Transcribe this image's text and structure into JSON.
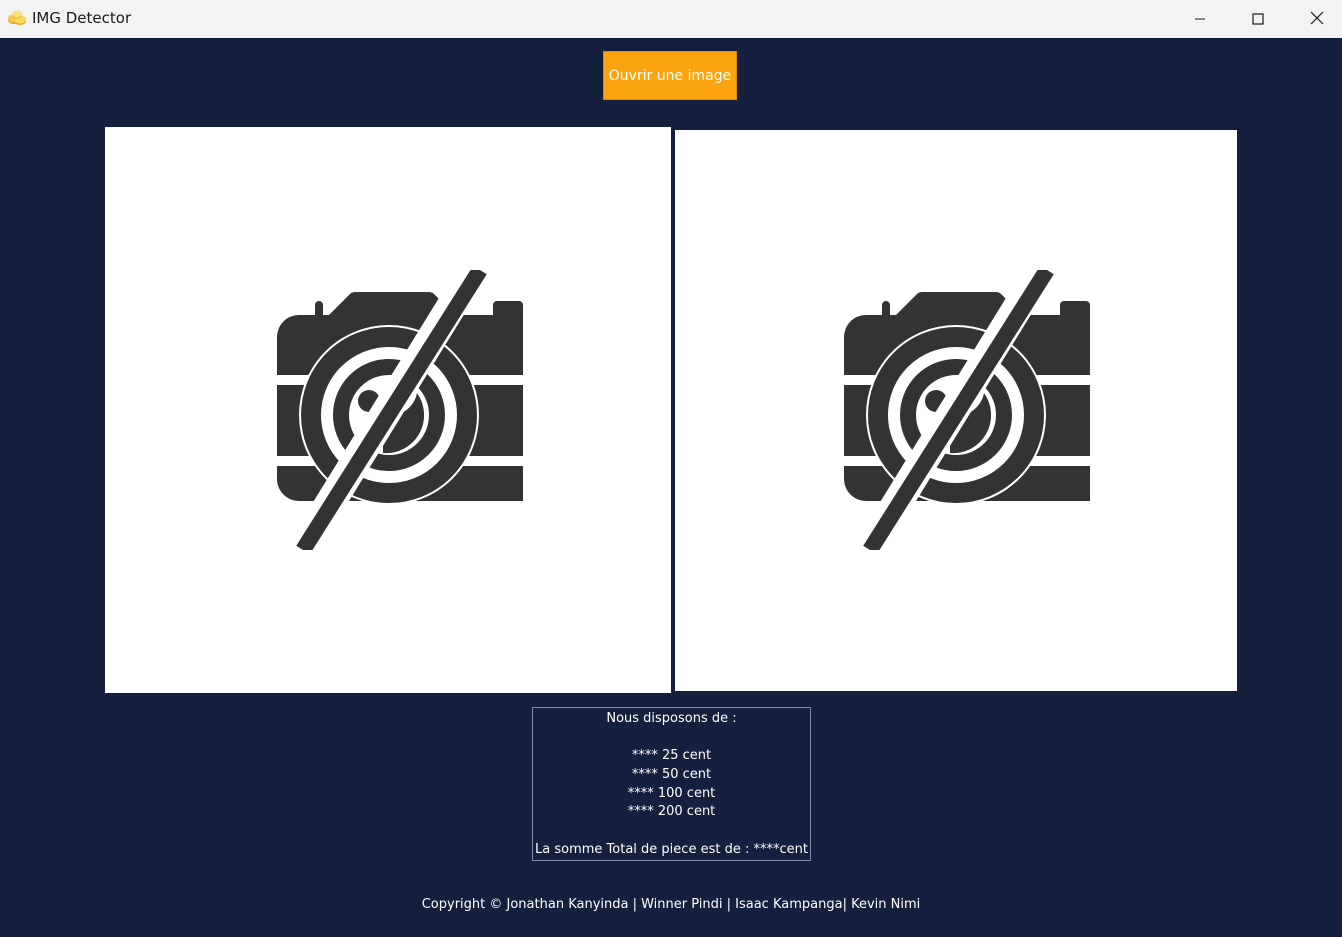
{
  "window": {
    "title": "IMG Detector",
    "controls": {
      "minimize_icon": "minimize-icon",
      "maximize_icon": "maximize-icon",
      "close_icon": "close-icon"
    }
  },
  "toolbar": {
    "open_button_label": "Ouvrir une image",
    "accent_color": "#fca40f"
  },
  "panels": [
    {
      "icon": "no-camera-icon"
    },
    {
      "icon": "no-camera-icon"
    }
  ],
  "summary": {
    "heading": "Nous disposons de :",
    "coins": [
      "**** 25  cent",
      "**** 50  cent",
      "**** 100 cent",
      "**** 200 cent"
    ],
    "total": "La somme Total de piece est de : ****cent"
  },
  "footer": {
    "copyright": "Copyright © Jonathan Kanyinda | Winner Pindi | Isaac Kampanga| Kevin Nimi"
  },
  "colors": {
    "background": "#14203d",
    "panel": "#ffffff",
    "icon": "#333333"
  }
}
